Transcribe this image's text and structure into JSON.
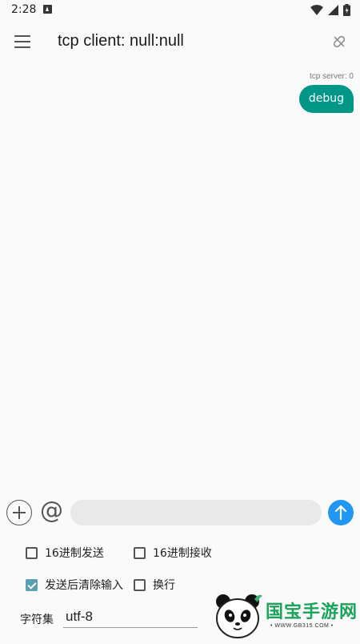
{
  "status_bar": {
    "time": "2:28"
  },
  "app_bar": {
    "title": "tcp client: null:null"
  },
  "messages": [
    {
      "sender": "tcp server: 0",
      "text": "debug"
    }
  ],
  "input_bar": {
    "at_label": "@",
    "message_value": "",
    "message_placeholder": ""
  },
  "options": {
    "hex_send": {
      "label": "16进制发送",
      "checked": false
    },
    "hex_receive": {
      "label": "16进制接收",
      "checked": false
    },
    "clear_after_send": {
      "label": "发送后清除输入",
      "checked": true
    },
    "newline": {
      "label": "换行",
      "checked": false
    }
  },
  "charset": {
    "label": "字符集",
    "value": "utf-8"
  },
  "watermark": {
    "text": "国宝手游网",
    "subtext": "• WWW.GB315.COM •"
  },
  "colors": {
    "accent": "#009688",
    "send": "#2196f3",
    "checkbox_checked": "#5a9fb2"
  }
}
